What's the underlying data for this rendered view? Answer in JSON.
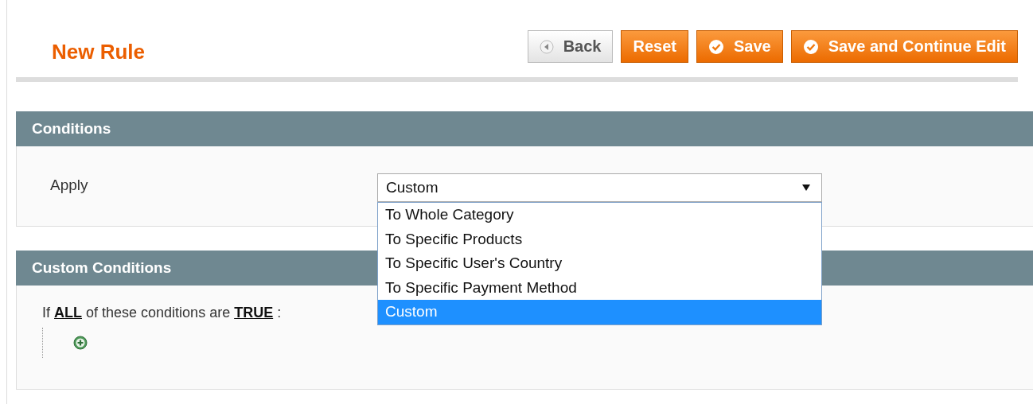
{
  "page_title": "New Rule",
  "buttons": [
    {
      "label": "Back",
      "kind": "back"
    },
    {
      "label": "Reset",
      "kind": "plain"
    },
    {
      "label": "Save",
      "kind": "check"
    },
    {
      "label": "Save and Continue Edit",
      "kind": "check"
    }
  ],
  "conditions": {
    "title": "Conditions",
    "field_label": "Apply",
    "select": {
      "value": "Custom",
      "expanded": true,
      "options": [
        {
          "label": "To Whole Category",
          "selected": false
        },
        {
          "label": "To Specific Products",
          "selected": false
        },
        {
          "label": "To Specific User's Country",
          "selected": false
        },
        {
          "label": "To Specific Payment Method",
          "selected": false
        },
        {
          "label": "Custom",
          "selected": true
        }
      ]
    }
  },
  "custom_conditions": {
    "title": "Custom Conditions",
    "sentence": [
      {
        "text": "If",
        "kind": "text"
      },
      {
        "text": "ALL",
        "kind": "link"
      },
      {
        "text": "of these conditions are",
        "kind": "text"
      },
      {
        "text": "TRUE",
        "kind": "link"
      },
      {
        "text": ":",
        "kind": "text"
      }
    ]
  }
}
